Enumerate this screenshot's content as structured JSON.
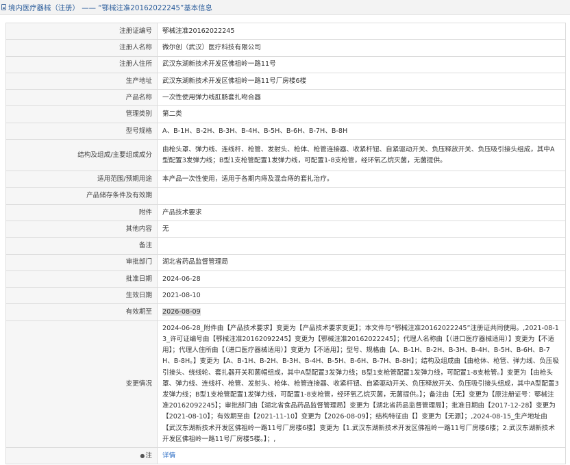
{
  "header": {
    "title": "境内医疗器械（注册） —— “鄂械注准20162022245”基本信息"
  },
  "rows": [
    {
      "label": "注册证编号",
      "value": "鄂械注准20162022245"
    },
    {
      "label": "注册人名称",
      "value": "微尔创（武汉）医疗科技有限公司"
    },
    {
      "label": "注册人住所",
      "value": "武汉东湖新技术开发区佛祖岭一路11号"
    },
    {
      "label": "生产地址",
      "value": "武汉东湖新技术开发区佛祖岭一路11号厂房楼6楼"
    },
    {
      "label": "产品名称",
      "value": "一次性使用弹力线肛肠套扎吻合器"
    },
    {
      "label": "管理类别",
      "value": "第二类"
    },
    {
      "label": "型号规格",
      "value": "A、B-1H、B-2H、B-3H、B-4H、B-5H、B-6H、B-7H、B-8H"
    },
    {
      "label": "结构及组成/主要组成成分",
      "value": "由枪头罩、弹力线、连线杆、枪管、发射头、枪体、枪管连接器、收紧杆钮、自紧驱动开关、负压释放开关、负压吸引接头组成，其中A型配置3发弹力线；B型1支枪管配置1发弹力线，可配置1-8支枪管，经环氧乙烷灭菌，无菌提供。"
    },
    {
      "label": "适用范围/预期用途",
      "value": "本产品一次性使用，适用于各期内痔及混合痔的套扎治疗。"
    },
    {
      "label": "产品储存条件及有效期",
      "value": ""
    },
    {
      "label": "附件",
      "value": "产品技术要求"
    },
    {
      "label": "其他内容",
      "value": "无"
    },
    {
      "label": "备注",
      "value": ""
    },
    {
      "label": "审批部门",
      "value": "湖北省药品监督管理局"
    },
    {
      "label": "批准日期",
      "value": "2024-06-28"
    },
    {
      "label": "生效日期",
      "value": "2021-08-10"
    },
    {
      "label": "有效期至",
      "value": "2026-08-09"
    },
    {
      "label": "变更情况",
      "value": "2024-06-28_附件由【产品技术要求】变更为【产品技术要求变更】；本文件与“鄂械注准20162022245”注册证共同使用。,2021-08-13_许可证编号由【鄂械注准20162092245】变更为【鄂械注准20162022245】；代理人名称由【（进口医疗器械适用）】变更为【不适用】；代理人住所由【（进口医疗器械适用）】变更为【不适用】；型号、规格由【A、B-1H、B-2H、B-3H、B-4H、B-5H、B-6H、B-7H、B-8H。】变更为【A、B-1H、B-2H、B-3H、B-4H、B-5H、B-6H、B-7H、B-8H】；结构及组成由【由枪体、枪管、弹力线、负压吸引接头、绕线轮、套扎器开关和菌帽组成，其中A型配置3发弹力线；B型1支枪管配置1发弹力线，可配置1-8支枪管。】变更为【由枪头罩、弹力线、连线杆、枪管、发射头、枪体、枪管连接器、收紧杆钮、自紧驱动开关、负压释放开关、负压吸引接头组成，其中A型配置3发弹力线；B型1支枪管配置1发弹力线，可配置1-8支枪管，经环氧乙烷灭菌，无菌提供。】；备注由【无】变更为【原注册证号：鄂械注准20162092245】；审批部门由【湖北省食品药品监督管理局】变更为【湖北省药品监督管理局】；批准日期由【2017-12-28】变更为【2021-08-10】；有效期至由【2021-11-10】变更为【2026-08-09】；结构特征由【】变更为【无源】；,2024-08-15_生产地址由【武汉东湖新技术开发区佛祖岭一路11号厂房楼6楼】变更为【1.武汉东湖新技术开发区佛祖岭一路11号厂房楼6楼；2.武汉东湖新技术开发区佛祖岭一路11号厂房楼5楼。】；,"
    },
    {
      "label": "注",
      "value": "详情"
    }
  ],
  "colors": {
    "title": "#2b5d9b",
    "link": "#2b6cc4",
    "label_bg": "#f6f6f6",
    "border": "#dcdcdc"
  },
  "icons": {
    "header": "document-icon",
    "note": "pin-icon"
  }
}
